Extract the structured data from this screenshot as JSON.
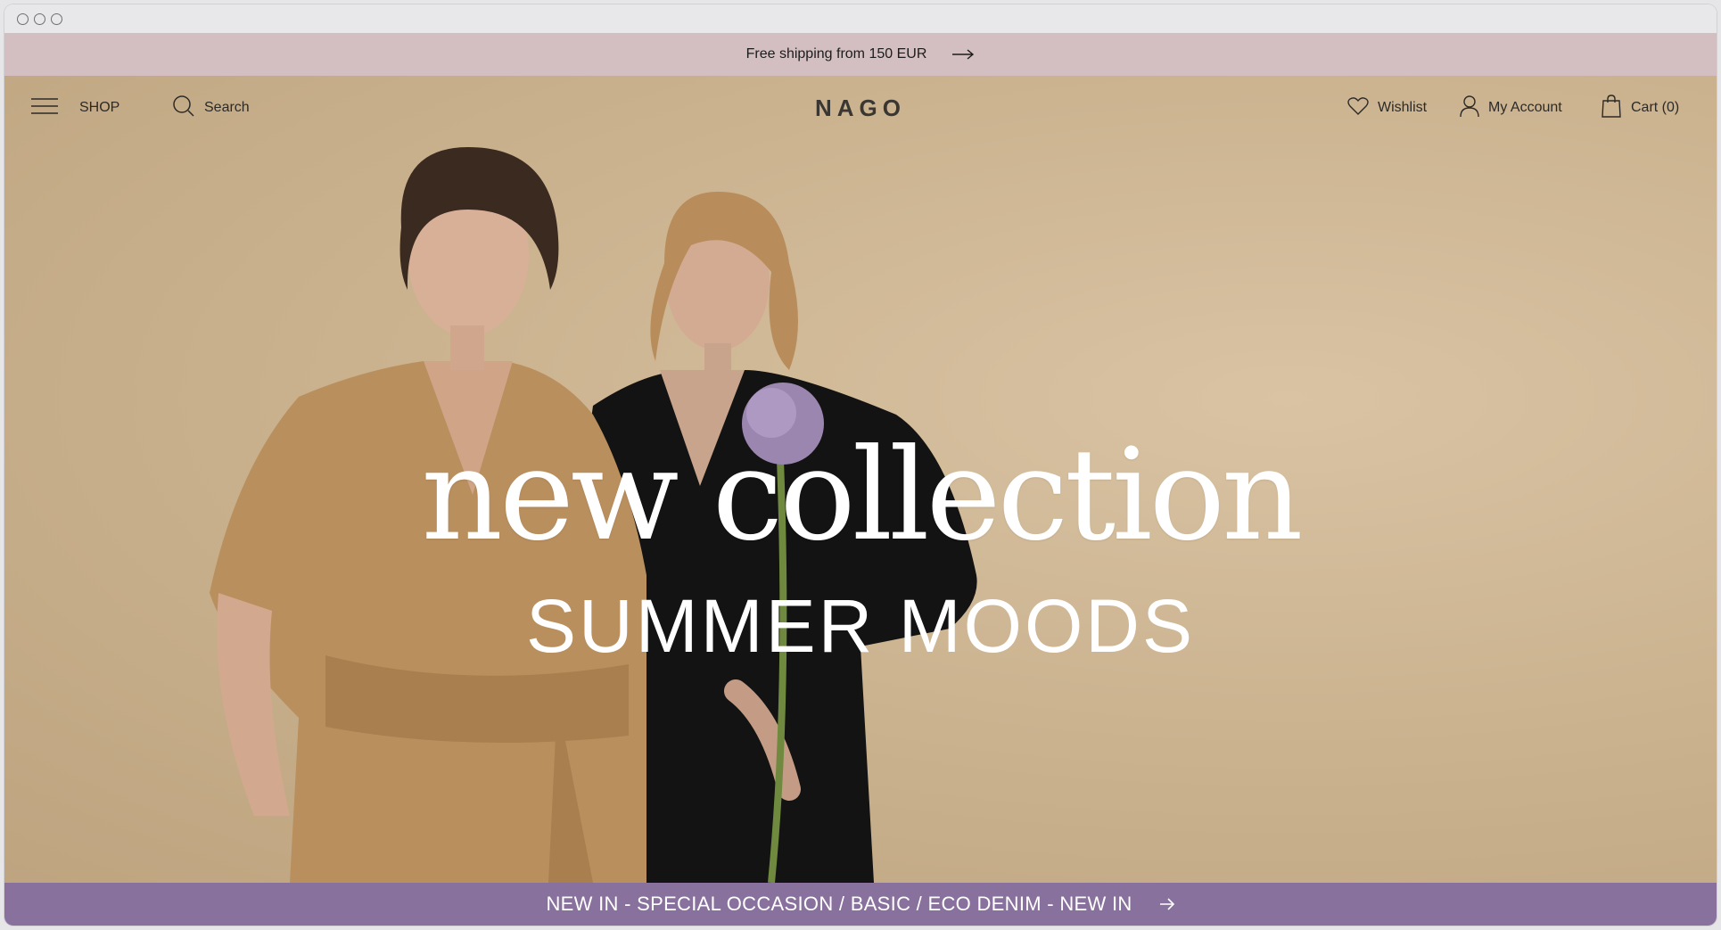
{
  "announcement": {
    "text": "Free shipping from 150 EUR",
    "icon": "arrow-right-icon"
  },
  "header": {
    "menu_label": "SHOP",
    "search_label": "Search",
    "logo": "NAGO",
    "wishlist_label": "Wishlist",
    "account_label": "My Account",
    "cart_label": "Cart (0)"
  },
  "hero": {
    "headline": "new collection",
    "subheadline": "SUMMER MOODS"
  },
  "promo_bar": {
    "text": "NEW IN - SPECIAL OCCASION / BASIC / ECO DENIM - NEW IN",
    "icon": "arrow-right-icon"
  },
  "colors": {
    "announcement_bg": "#d3bfc1",
    "hero_bg": "#ccb491",
    "promo_bg": "#89719d",
    "text_dark": "#2c2a27"
  }
}
